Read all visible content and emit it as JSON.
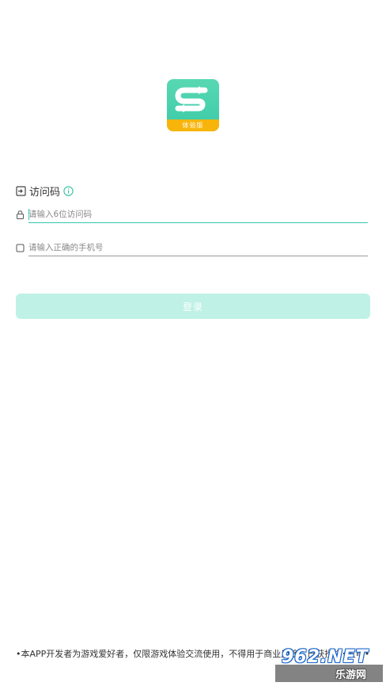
{
  "app": {
    "logo_badge": "体验版",
    "logo_icon": "s-arrows-logo-icon",
    "brand_color": "#3ccaa7",
    "badge_color": "#f7b50c"
  },
  "access": {
    "title": "访问码",
    "code_placeholder": "请输入6位访问码",
    "phone_placeholder": "请输入正确的手机号"
  },
  "login": {
    "label": "登录",
    "color": "#bff1e6"
  },
  "footer": {
    "disclaimer": "•本APP开发者为游戏爱好者，仅限游戏体验交流使用，不得用于商业用途，已获授权•发电•"
  },
  "watermark": {
    "top": "962.NET",
    "bottom": "乐游网"
  }
}
